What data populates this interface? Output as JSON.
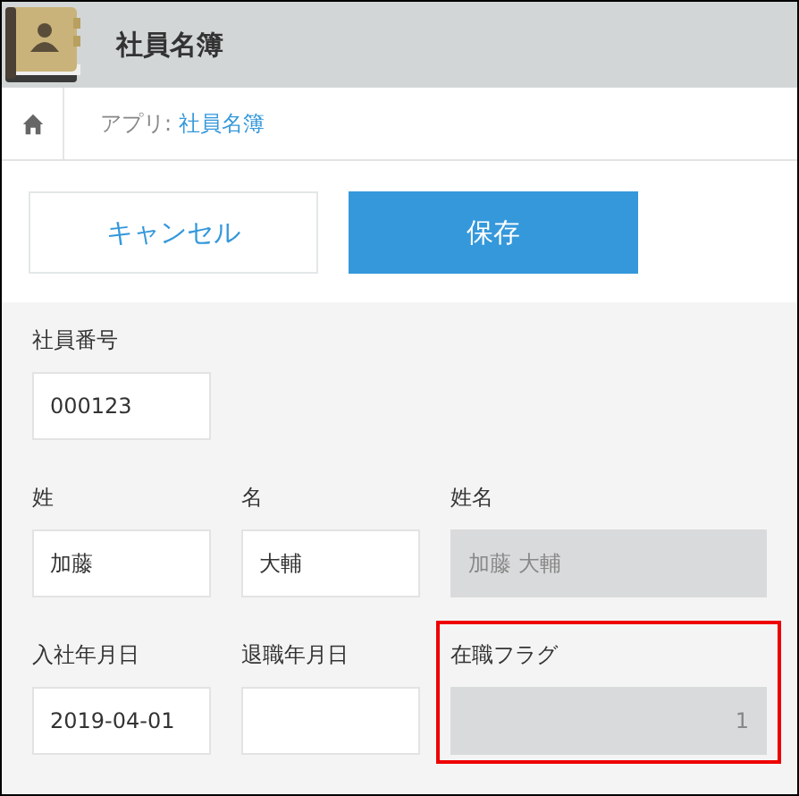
{
  "header": {
    "title": "社員名簿"
  },
  "breadcrumb": {
    "prefix": "アプリ:",
    "link": "社員名簿"
  },
  "buttons": [
    {
      "label": "キャンセル",
      "kind": "secondary"
    },
    {
      "label": "保存",
      "kind": "primary"
    }
  ],
  "form_rows": [
    {
      "fields": [
        {
          "label": "社員番号",
          "value": "000123",
          "kind": "text",
          "highlighted": false
        }
      ]
    },
    {
      "fields": [
        {
          "label": "姓",
          "value": "加藤",
          "kind": "text",
          "highlighted": false
        },
        {
          "label": "名",
          "value": "大輔",
          "kind": "text",
          "highlighted": false
        },
        {
          "label": "姓名",
          "value": "加藤 大輔",
          "kind": "calc-text",
          "highlighted": false
        }
      ]
    },
    {
      "fields": [
        {
          "label": "入社年月日",
          "value": "2019-04-01",
          "kind": "text",
          "highlighted": false
        },
        {
          "label": "退職年月日",
          "kind": "text",
          "highlighted": false
        },
        {
          "label": "在職フラグ",
          "value": "1",
          "kind": "calc-number",
          "highlighted": true
        }
      ]
    }
  ]
}
